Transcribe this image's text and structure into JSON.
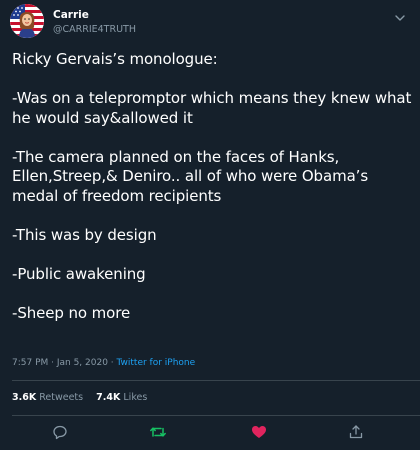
{
  "author": {
    "display_name": "Carrie",
    "handle": "@CARRIE4TRUTH"
  },
  "tweet": {
    "paragraphs": [
      "Ricky Gervais’s monologue:",
      "-Was on a telepromptor which means they knew what he would say&allowed it",
      "-The camera planned on the faces of Hanks, Ellen,Streep,& Deniro.. all of who were Obama’s medal of freedom recipients",
      "-This was by design",
      "-Public awakening",
      "-Sheep no more"
    ],
    "timestamp": "7:57 PM · Jan 5, 2020",
    "separator": " · ",
    "source": "Twitter for iPhone"
  },
  "stats": {
    "retweets_count": "3.6K",
    "retweets_label": "Retweets",
    "likes_count": "7.4K",
    "likes_label": "Likes"
  },
  "actions": {
    "reply_icon": "reply-icon",
    "retweet_icon": "retweet-icon",
    "like_icon": "heart-icon",
    "share_icon": "share-icon",
    "retweet_color": "#17bf63",
    "like_color": "#e0245e"
  },
  "colors": {
    "background": "#15202b",
    "secondary_text": "#8899a6",
    "link": "#1da1f2",
    "divider": "#38444d"
  }
}
